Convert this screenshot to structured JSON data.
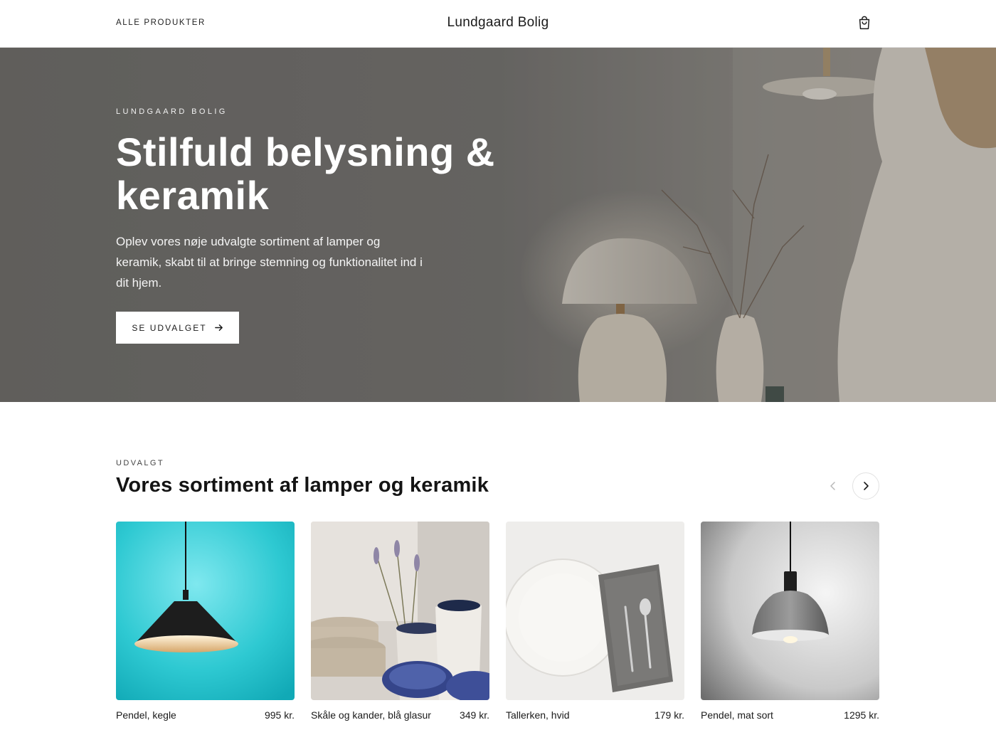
{
  "header": {
    "nav_label": "ALLE PRODUKTER",
    "brand": "Lundgaard Bolig",
    "cart_icon": "shopping-bag-icon"
  },
  "hero": {
    "eyebrow": "LUNDGAARD BOLIG",
    "title": "Stilfuld belysning & keramik",
    "text": "Oplev vores nøje udvalgte sortiment af lamper og keramik, skabt til at bringe stemning og funktionalitet ind i dit hjem.",
    "button_label": "SE UDVALGET",
    "button_icon": "arrow-right-icon"
  },
  "featured": {
    "eyebrow": "UDVALGT",
    "title": "Vores sortiment af lamper og keramik",
    "prev_icon": "chevron-left-icon",
    "next_icon": "chevron-right-icon",
    "products": [
      {
        "name": "Pendel, kegle",
        "price": "995 kr.",
        "image": "teal-cone-pendant-lamp"
      },
      {
        "name": "Skåle og kander, blå glasur",
        "price": "349 kr.",
        "image": "ceramic-bowls-and-jugs"
      },
      {
        "name": "Tallerken, hvid",
        "price": "179 kr.",
        "image": "white-plate-with-cutlery"
      },
      {
        "name": "Pendel, mat sort",
        "price": "1295 kr.",
        "image": "grey-pendant-lamp"
      }
    ]
  },
  "colors": {
    "hero_overlay": "#6d6b69",
    "button_bg": "#ffffff",
    "text_dark": "#1a1a1a",
    "teal": "#2ec9d2"
  }
}
